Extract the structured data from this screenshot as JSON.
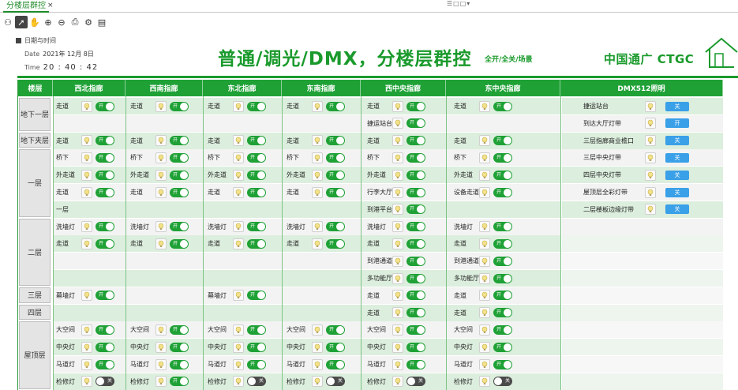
{
  "tab": {
    "label": "分楼层群控",
    "close": "×"
  },
  "window_controls": "☰□□▾",
  "datetime": {
    "title": "日期与时间",
    "date_label": "Date",
    "date_value": "2021年 12月 8日",
    "time_label": "Time",
    "time_value": "20 : 40 : 42"
  },
  "title": "普通/调光/DMX，分楼层群控",
  "subtitle": "全开/全关/场景",
  "logo": "中国通广 CTGC",
  "colors": {
    "accent": "#1fa136",
    "dmx_button": "#3aa0e8",
    "switch_off": "#4a4a4a"
  },
  "columns": {
    "floor": "楼层",
    "zones": [
      "西北指廊",
      "西南指廊",
      "东北指廊",
      "东南指廊",
      "西中央指廊",
      "东中央指廊"
    ],
    "dmx": "DMX512照明"
  },
  "switch_text": {
    "on": "开",
    "off": "关"
  },
  "floors": [
    {
      "name": "地下一层",
      "row": 0,
      "span": 2
    },
    {
      "name": "地下夹层",
      "row": 2,
      "span": 1
    },
    {
      "name": "一层",
      "row": 3,
      "span": 4
    },
    {
      "name": "二层",
      "row": 7,
      "span": 4
    },
    {
      "name": "三层",
      "row": 11,
      "span": 1
    },
    {
      "name": "四层",
      "row": 12,
      "span": 1
    },
    {
      "name": "屋顶层",
      "row": 13,
      "span": 4
    }
  ],
  "cells": [
    {
      "r": 0,
      "c": 0,
      "label": "走道",
      "on": true
    },
    {
      "r": 0,
      "c": 1,
      "label": "走道",
      "on": true
    },
    {
      "r": 0,
      "c": 2,
      "label": "走道",
      "on": true
    },
    {
      "r": 0,
      "c": 3,
      "label": "走道",
      "on": true
    },
    {
      "r": 0,
      "c": 4,
      "label": "走道",
      "on": true
    },
    {
      "r": 0,
      "c": 5,
      "label": "走道",
      "on": true
    },
    {
      "r": 1,
      "c": 4,
      "label": "捷运站台",
      "on": true
    },
    {
      "r": 2,
      "c": 0,
      "label": "走道",
      "on": true
    },
    {
      "r": 2,
      "c": 1,
      "label": "走道",
      "on": true
    },
    {
      "r": 2,
      "c": 2,
      "label": "走道",
      "on": true
    },
    {
      "r": 2,
      "c": 3,
      "label": "走道",
      "on": true
    },
    {
      "r": 2,
      "c": 4,
      "label": "走道",
      "on": true
    },
    {
      "r": 2,
      "c": 5,
      "label": "走道",
      "on": true
    },
    {
      "r": 3,
      "c": 0,
      "label": "桥下",
      "on": true
    },
    {
      "r": 3,
      "c": 1,
      "label": "桥下",
      "on": true
    },
    {
      "r": 3,
      "c": 2,
      "label": "桥下",
      "on": true
    },
    {
      "r": 3,
      "c": 3,
      "label": "桥下",
      "on": true
    },
    {
      "r": 3,
      "c": 4,
      "label": "桥下",
      "on": true
    },
    {
      "r": 3,
      "c": 5,
      "label": "桥下",
      "on": true
    },
    {
      "r": 4,
      "c": 0,
      "label": "外走道",
      "on": true
    },
    {
      "r": 4,
      "c": 1,
      "label": "外走道",
      "on": true
    },
    {
      "r": 4,
      "c": 2,
      "label": "外走道",
      "on": true
    },
    {
      "r": 4,
      "c": 3,
      "label": "外走道",
      "on": true
    },
    {
      "r": 4,
      "c": 4,
      "label": "外走道",
      "on": true
    },
    {
      "r": 4,
      "c": 5,
      "label": "外走道",
      "on": true
    },
    {
      "r": 5,
      "c": 0,
      "label": "走道",
      "on": true
    },
    {
      "r": 5,
      "c": 1,
      "label": "走道",
      "on": true
    },
    {
      "r": 5,
      "c": 2,
      "label": "走道",
      "on": true
    },
    {
      "r": 5,
      "c": 3,
      "label": "走道",
      "on": true
    },
    {
      "r": 5,
      "c": 4,
      "label": "行李大厅",
      "on": true
    },
    {
      "r": 5,
      "c": 5,
      "label": "设备走道",
      "on": true
    },
    {
      "r": 6,
      "c": 0,
      "label": "一层",
      "on": null
    },
    {
      "r": 6,
      "c": 4,
      "label": "到港平台",
      "on": true
    },
    {
      "r": 7,
      "c": 0,
      "label": "洗墙灯",
      "on": true
    },
    {
      "r": 7,
      "c": 1,
      "label": "洗墙灯",
      "on": true
    },
    {
      "r": 7,
      "c": 2,
      "label": "洗墙灯",
      "on": true
    },
    {
      "r": 7,
      "c": 3,
      "label": "洗墙灯",
      "on": true
    },
    {
      "r": 7,
      "c": 4,
      "label": "洗墙灯",
      "on": true
    },
    {
      "r": 7,
      "c": 5,
      "label": "洗墙灯",
      "on": true
    },
    {
      "r": 8,
      "c": 0,
      "label": "走道",
      "on": true
    },
    {
      "r": 8,
      "c": 1,
      "label": "走道",
      "on": true
    },
    {
      "r": 8,
      "c": 2,
      "label": "走道",
      "on": true
    },
    {
      "r": 8,
      "c": 3,
      "label": "走道",
      "on": true
    },
    {
      "r": 8,
      "c": 4,
      "label": "走道",
      "on": true
    },
    {
      "r": 8,
      "c": 5,
      "label": "走道",
      "on": true
    },
    {
      "r": 9,
      "c": 4,
      "label": "到港通道",
      "on": true
    },
    {
      "r": 9,
      "c": 5,
      "label": "到港通道",
      "on": true
    },
    {
      "r": 10,
      "c": 4,
      "label": "多功能厅",
      "on": true
    },
    {
      "r": 10,
      "c": 5,
      "label": "多功能厅",
      "on": true
    },
    {
      "r": 11,
      "c": 0,
      "label": "幕墙灯",
      "on": true
    },
    {
      "r": 11,
      "c": 2,
      "label": "幕墙灯",
      "on": true
    },
    {
      "r": 11,
      "c": 4,
      "label": "走道",
      "on": true
    },
    {
      "r": 11,
      "c": 5,
      "label": "走道",
      "on": true
    },
    {
      "r": 12,
      "c": 4,
      "label": "走道",
      "on": true
    },
    {
      "r": 12,
      "c": 5,
      "label": "走道",
      "on": true
    },
    {
      "r": 13,
      "c": 0,
      "label": "大空间",
      "on": true
    },
    {
      "r": 13,
      "c": 1,
      "label": "大空间",
      "on": true
    },
    {
      "r": 13,
      "c": 2,
      "label": "大空间",
      "on": true
    },
    {
      "r": 13,
      "c": 3,
      "label": "大空间",
      "on": true
    },
    {
      "r": 13,
      "c": 4,
      "label": "大空间",
      "on": true
    },
    {
      "r": 13,
      "c": 5,
      "label": "大空间",
      "on": true
    },
    {
      "r": 14,
      "c": 0,
      "label": "中央灯",
      "on": true
    },
    {
      "r": 14,
      "c": 1,
      "label": "中央灯",
      "on": true
    },
    {
      "r": 14,
      "c": 2,
      "label": "中央灯",
      "on": true
    },
    {
      "r": 14,
      "c": 3,
      "label": "中央灯",
      "on": true
    },
    {
      "r": 14,
      "c": 4,
      "label": "中央灯",
      "on": true
    },
    {
      "r": 14,
      "c": 5,
      "label": "中央灯",
      "on": true
    },
    {
      "r": 15,
      "c": 0,
      "label": "马道灯",
      "on": true
    },
    {
      "r": 15,
      "c": 1,
      "label": "马道灯",
      "on": true
    },
    {
      "r": 15,
      "c": 2,
      "label": "马道灯",
      "on": true
    },
    {
      "r": 15,
      "c": 3,
      "label": "马道灯",
      "on": true
    },
    {
      "r": 15,
      "c": 4,
      "label": "马道灯",
      "on": true
    },
    {
      "r": 15,
      "c": 5,
      "label": "马道灯",
      "on": true
    },
    {
      "r": 16,
      "c": 0,
      "label": "检修灯",
      "on": false
    },
    {
      "r": 16,
      "c": 1,
      "label": "检修灯",
      "on": true
    },
    {
      "r": 16,
      "c": 2,
      "label": "检修灯",
      "on": false
    },
    {
      "r": 16,
      "c": 3,
      "label": "检修灯",
      "on": false
    },
    {
      "r": 16,
      "c": 4,
      "label": "检修灯",
      "on": false
    },
    {
      "r": 16,
      "c": 5,
      "label": "检修灯",
      "on": false
    }
  ],
  "dmx_rows": [
    {
      "label": "捷运站台",
      "button": "关"
    },
    {
      "label": "到达大厅灯带",
      "button": "开"
    },
    {
      "label": "三层指廊商业檐口",
      "button": "关"
    },
    {
      "label": "三层中央灯带",
      "button": "关"
    },
    {
      "label": "四层中央灯带",
      "button": "关"
    },
    {
      "label": "屋顶层全彩灯带",
      "button": "关"
    },
    {
      "label": "二层楼板边缘灯带",
      "button": "关"
    }
  ]
}
